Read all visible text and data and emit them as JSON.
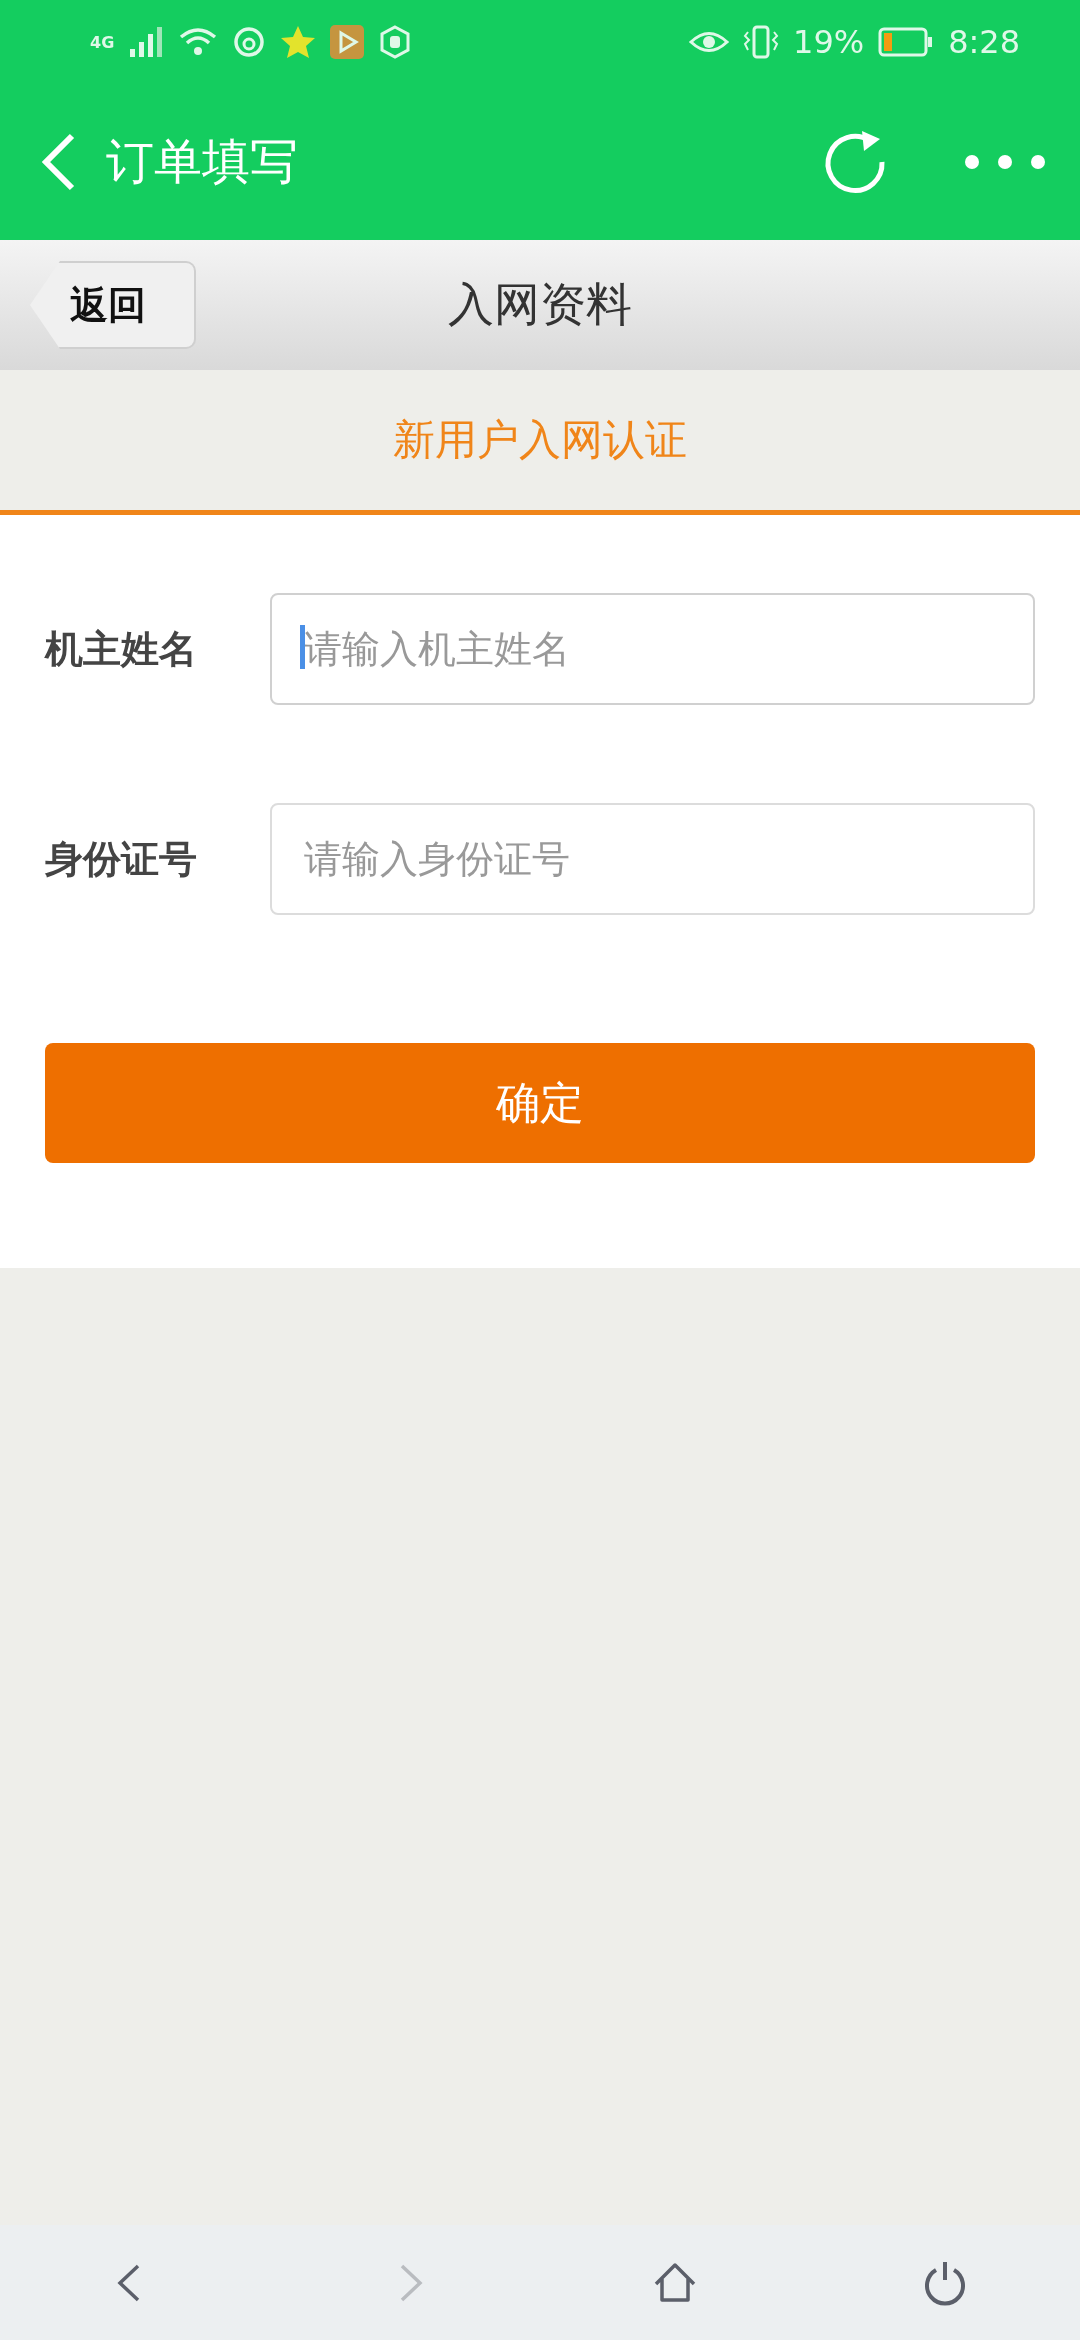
{
  "status_bar": {
    "network": "4G",
    "battery": "19%",
    "time": "8:28"
  },
  "app_bar": {
    "title": "订单填写"
  },
  "nav_bar": {
    "back": "返回",
    "title": "入网资料"
  },
  "section": {
    "title": "新用户入网认证"
  },
  "fields": [
    {
      "label": "机主姓名",
      "placeholder": "请输入机主姓名",
      "focused": true
    },
    {
      "label": "身份证号",
      "placeholder": "请输入身份证号",
      "focused": false
    }
  ],
  "submit": "确定",
  "bottom_nav": [
    {
      "kind": "back",
      "disabled": false
    },
    {
      "kind": "forward",
      "disabled": true
    },
    {
      "kind": "home",
      "disabled": false
    },
    {
      "kind": "power",
      "disabled": false
    }
  ]
}
